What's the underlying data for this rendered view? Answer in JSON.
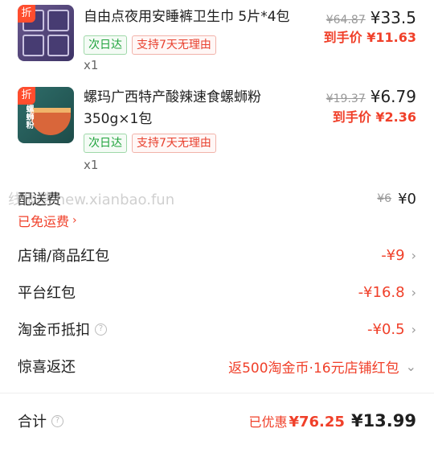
{
  "products": [
    {
      "badge": "折",
      "title": "自由点夜用安睡裤卫生巾 5片*4包",
      "tags": [
        "次日达",
        "支持7天无理由"
      ],
      "qty": "x1",
      "original_price": "¥64.87",
      "price": "¥33.5",
      "final_label": "到手价",
      "final_price": "¥11.63"
    },
    {
      "badge": "折",
      "title": "螺玛广西特产酸辣速食螺蛳粉 350g×1包",
      "tags": [
        "次日达",
        "支持7天无理由"
      ],
      "qty": "x1",
      "original_price": "¥19.37",
      "price": "¥6.79",
      "final_label": "到手价",
      "final_price": "¥2.36",
      "thumb_label": "螺蛳粉"
    }
  ],
  "watermark": "线报酷 new.xianbao.fun",
  "shipping": {
    "label": "配送费",
    "original": "¥6",
    "value": "¥0",
    "note": "已免运费"
  },
  "rows": [
    {
      "label": "店铺/商品红包",
      "value": "-¥9"
    },
    {
      "label": "平台红包",
      "value": "-¥16.8"
    },
    {
      "label": "淘金币抵扣",
      "value": "-¥0.5"
    },
    {
      "label": "惊喜返还",
      "value": "返500淘金币·16元店铺红包"
    }
  ],
  "total": {
    "label": "合计",
    "discount_label": "已优惠",
    "discount": "¥76.25",
    "value": "¥13.99"
  },
  "colors": {
    "accent": "#f0402a",
    "green": "#1fa33c"
  }
}
